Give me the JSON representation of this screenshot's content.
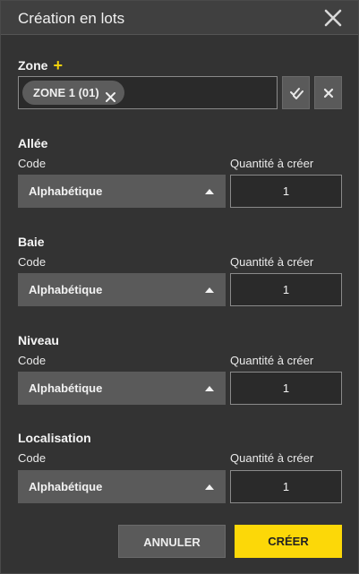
{
  "dialog": {
    "title": "Création en lots",
    "close_icon": "close-icon"
  },
  "zone": {
    "label": "Zone",
    "add_symbol": "+",
    "chips": [
      {
        "label": "ZONE 1 (01)"
      }
    ],
    "select_all_icon": "double-check-icon",
    "clear_icon": "close-small-icon"
  },
  "sections": [
    {
      "title": "Allée",
      "code_label": "Code",
      "code_value": "Alphabétique",
      "qty_label": "Quantité à créer",
      "qty_value": "1"
    },
    {
      "title": "Baie",
      "code_label": "Code",
      "code_value": "Alphabétique",
      "qty_label": "Quantité à créer",
      "qty_value": "1"
    },
    {
      "title": "Niveau",
      "code_label": "Code",
      "code_value": "Alphabétique",
      "qty_label": "Quantité à créer",
      "qty_value": "1"
    },
    {
      "title": "Localisation",
      "code_label": "Code",
      "code_value": "Alphabétique",
      "qty_label": "Quantité à créer",
      "qty_value": "1"
    }
  ],
  "actions": {
    "cancel": "ANNULER",
    "create": "CRÉER"
  },
  "colors": {
    "accent": "#fcd808",
    "background": "#333333",
    "control": "#5a5a5a"
  }
}
